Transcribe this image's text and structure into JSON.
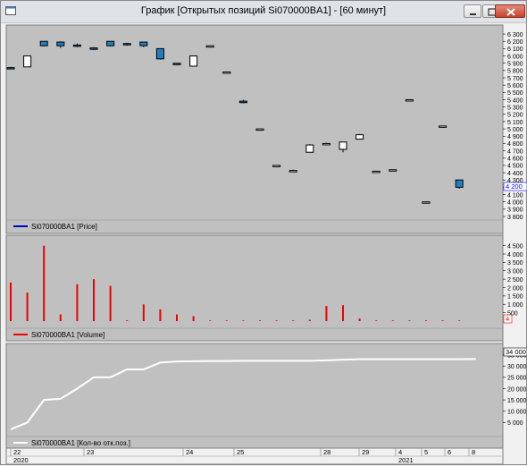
{
  "window": {
    "title": "График [Открытых позиций Si070000BA1] - [60 минут]",
    "controls": [
      "minimize",
      "restore",
      "close"
    ]
  },
  "colors": {
    "panel_bg": "#c0c0c0",
    "candle_up": "#ffffff",
    "candle_down": "#1f7fc4",
    "volume": "#ee0000",
    "open_interest": "#ffffff",
    "price_legend": "#0000cc",
    "current_price_label": "#0000ff"
  },
  "panels": {
    "price": {
      "legend": "Si070000BA1 [Price]",
      "y_ticks": [
        "6 300",
        "6 200",
        "6 100",
        "6 000",
        "5 900",
        "5 800",
        "5 700",
        "5 600",
        "5 500",
        "5 400",
        "5 300",
        "5 200",
        "5 100",
        "5 000",
        "4 900",
        "4 800",
        "4 700",
        "4 600",
        "4 500",
        "4 400",
        "4 300",
        "4 200",
        "4 100",
        "4 000",
        "3 900",
        "3 800"
      ],
      "current_value": "4 200"
    },
    "volume": {
      "legend": "Si070000BA1 [Volume]",
      "y_ticks": [
        "4 500",
        "4 000",
        "3 500",
        "3 000",
        "2 500",
        "2 000",
        "1 500",
        "1 000",
        "500"
      ],
      "current_value": "4"
    },
    "open_interest": {
      "legend": "Si070000BA1 [Кол-во отк.поз.]",
      "y_ticks": [
        "35 000",
        "30 000",
        "25 000",
        "20 000",
        "15 000",
        "10 000",
        "5 000"
      ],
      "current_value": "34 000"
    }
  },
  "x_axis": {
    "day_labels": [
      "22",
      "23",
      "24",
      "25",
      "28",
      "29",
      "4",
      "5",
      "6",
      "8"
    ],
    "year_labels": [
      "2020",
      "2021"
    ]
  },
  "chart_data": [
    {
      "type": "candlestick",
      "legend": "Si070000BA1 [Price]",
      "ylim": [
        3800,
        6350
      ],
      "candles": [
        {
          "o": 5840,
          "h": 5850,
          "l": 5830,
          "c": 5830
        },
        {
          "o": 5850,
          "h": 6000,
          "l": 5850,
          "c": 6000
        },
        {
          "o": 6200,
          "h": 6200,
          "l": 6130,
          "c": 6140
        },
        {
          "o": 6190,
          "h": 6200,
          "l": 6110,
          "c": 6140
        },
        {
          "o": 6150,
          "h": 6170,
          "l": 6120,
          "c": 6140
        },
        {
          "o": 6110,
          "h": 6120,
          "l": 6080,
          "c": 6090
        },
        {
          "o": 6200,
          "h": 6200,
          "l": 6130,
          "c": 6140
        },
        {
          "o": 6170,
          "h": 6180,
          "l": 6140,
          "c": 6160
        },
        {
          "o": 6190,
          "h": 6190,
          "l": 6120,
          "c": 6140
        },
        {
          "o": 6100,
          "h": 6100,
          "l": 5950,
          "c": 5960
        },
        {
          "o": 5900,
          "h": 5900,
          "l": 5880,
          "c": 5880
        },
        {
          "o": 5860,
          "h": 6000,
          "l": 5860,
          "c": 6000
        },
        {
          "o": 6140,
          "h": 6140,
          "l": 6140,
          "c": 6140
        },
        {
          "o": 5780,
          "h": 5780,
          "l": 5780,
          "c": 5780
        },
        {
          "o": 5380,
          "h": 5400,
          "l": 5350,
          "c": 5360
        },
        {
          "o": 5000,
          "h": 5000,
          "l": 5000,
          "c": 5000
        },
        {
          "o": 4500,
          "h": 4500,
          "l": 4500,
          "c": 4500
        },
        {
          "o": 4420,
          "h": 4440,
          "l": 4420,
          "c": 4430
        },
        {
          "o": 4680,
          "h": 4790,
          "l": 4680,
          "c": 4780
        },
        {
          "o": 4800,
          "h": 4810,
          "l": 4790,
          "c": 4800
        },
        {
          "o": 4720,
          "h": 4820,
          "l": 4680,
          "c": 4820
        },
        {
          "o": 4860,
          "h": 4930,
          "l": 4860,
          "c": 4920
        },
        {
          "o": 4420,
          "h": 4420,
          "l": 4420,
          "c": 4420
        },
        {
          "o": 4440,
          "h": 4440,
          "l": 4440,
          "c": 4440
        },
        {
          "o": 5400,
          "h": 5400,
          "l": 5400,
          "c": 5400
        },
        {
          "o": 4000,
          "h": 4000,
          "l": 4000,
          "c": 4000
        },
        {
          "o": 5040,
          "h": 5040,
          "l": 5040,
          "c": 5040
        },
        {
          "o": 4300,
          "h": 4300,
          "l": 4180,
          "c": 4200
        }
      ]
    },
    {
      "type": "bar",
      "legend": "Si070000BA1 [Volume]",
      "ylim": [
        0,
        4800
      ],
      "values": [
        2300,
        1700,
        4500,
        400,
        2200,
        2500,
        2100,
        50,
        1000,
        700,
        400,
        300,
        40,
        40,
        40,
        40,
        40,
        40,
        80,
        900,
        950,
        150,
        40,
        40,
        40,
        40,
        40,
        40
      ],
      "extra_points": [
        [
          9,
          800
        ],
        [
          14,
          200
        ]
      ]
    },
    {
      "type": "line",
      "legend": "Si070000BA1 [Кол-во отк.поз.]",
      "ylim": [
        0,
        38000
      ],
      "points": [
        [
          0,
          2000
        ],
        [
          1,
          5000
        ],
        [
          2,
          15000
        ],
        [
          3,
          15500
        ],
        [
          4,
          20000
        ],
        [
          5,
          25000
        ],
        [
          6,
          25000
        ],
        [
          7,
          28500
        ],
        [
          7.5,
          28500
        ],
        [
          8,
          28500
        ],
        [
          9,
          31500
        ],
        [
          10,
          32000
        ],
        [
          11,
          32100
        ],
        [
          12,
          32200
        ],
        [
          13,
          32200
        ],
        [
          14,
          32300
        ],
        [
          15,
          32300
        ],
        [
          16,
          32300
        ],
        [
          17,
          32300
        ],
        [
          18,
          32300
        ],
        [
          19,
          32500
        ],
        [
          20,
          32800
        ],
        [
          21,
          33000
        ],
        [
          22,
          33000
        ],
        [
          23,
          33000
        ],
        [
          24,
          33000
        ],
        [
          25,
          33000
        ],
        [
          26,
          33000
        ],
        [
          27,
          33000
        ],
        [
          28,
          33100
        ]
      ]
    }
  ]
}
